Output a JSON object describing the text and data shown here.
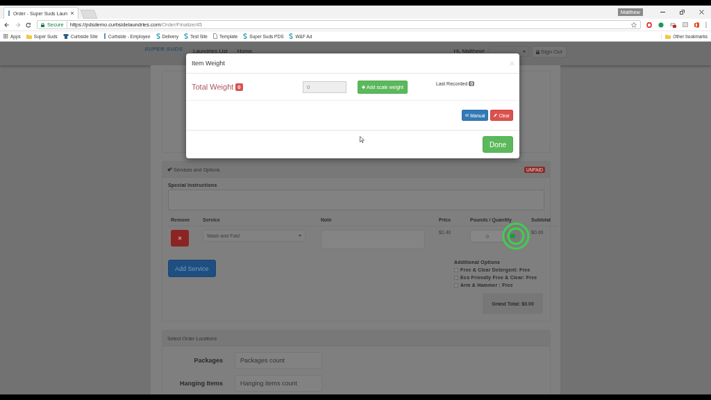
{
  "browser": {
    "tabs": [
      {
        "title": "Order - Super Suds Laun",
        "selected": true
      }
    ],
    "profile": "Matthew",
    "address": {
      "secure_label": "Secure",
      "url_host": "https://pdsdemo.curbsidelaundries.com",
      "url_path": "/Order/Finalize/45"
    },
    "bookmarks": [
      {
        "label": "Apps",
        "kind": "apps"
      },
      {
        "label": "Super Suds",
        "kind": "folder"
      },
      {
        "label": "Curbside Site",
        "kind": "shirt"
      },
      {
        "label": "Curbside - Employee",
        "kind": "bar"
      },
      {
        "label": "Delivery",
        "kind": "site"
      },
      {
        "label": "Test Site",
        "kind": "site"
      },
      {
        "label": "Template",
        "kind": "page"
      },
      {
        "label": "Super Suds PDS",
        "kind": "site"
      },
      {
        "label": "W&F Ad",
        "kind": "site"
      }
    ],
    "other_bookmarks": "Other bookmarks"
  },
  "navbar": {
    "logo": "SUPER SUDS",
    "links": [
      "Laundries List",
      "Home"
    ],
    "greeting": "Hi, Matthew!",
    "sign_out": "Sign Out"
  },
  "services": {
    "heading": "Services and Options",
    "status": "UNPAID",
    "special_instructions": "Special Instructions",
    "columns": [
      "Remove",
      "Service",
      "Note",
      "Price",
      "Pounds / Quantity",
      "Subtotal"
    ],
    "rows": [
      {
        "service": "Wash and Fold",
        "price": "$1.40",
        "quantity": "0",
        "subtotal": "$0.00"
      }
    ],
    "add_service": "Add Service",
    "additional_options": "Additional Options",
    "options": [
      {
        "label": "Free & Clear Detergent: Free",
        "checked": false
      },
      {
        "label": "Eco Friendly Free & Clear: Free",
        "checked": false
      },
      {
        "label": "Arm & Hammer : Free",
        "checked": false
      }
    ],
    "grand_total": "Grand Total: $0.00"
  },
  "locations": {
    "heading": "Select Order Locations",
    "fields": [
      {
        "label": "Packages",
        "placeholder": "Packages count"
      },
      {
        "label": "Hanging Items",
        "placeholder": "Hanging items count"
      }
    ]
  },
  "modal": {
    "title": "Item Weight",
    "total_label": "Total Weight",
    "total_badge": "0",
    "weight_value": "0",
    "add_button": "Add scale weight",
    "last_recorded": "Last Recorded",
    "last_badge": "0",
    "manual": "Manual",
    "clear": "Clear",
    "done": "Done"
  }
}
